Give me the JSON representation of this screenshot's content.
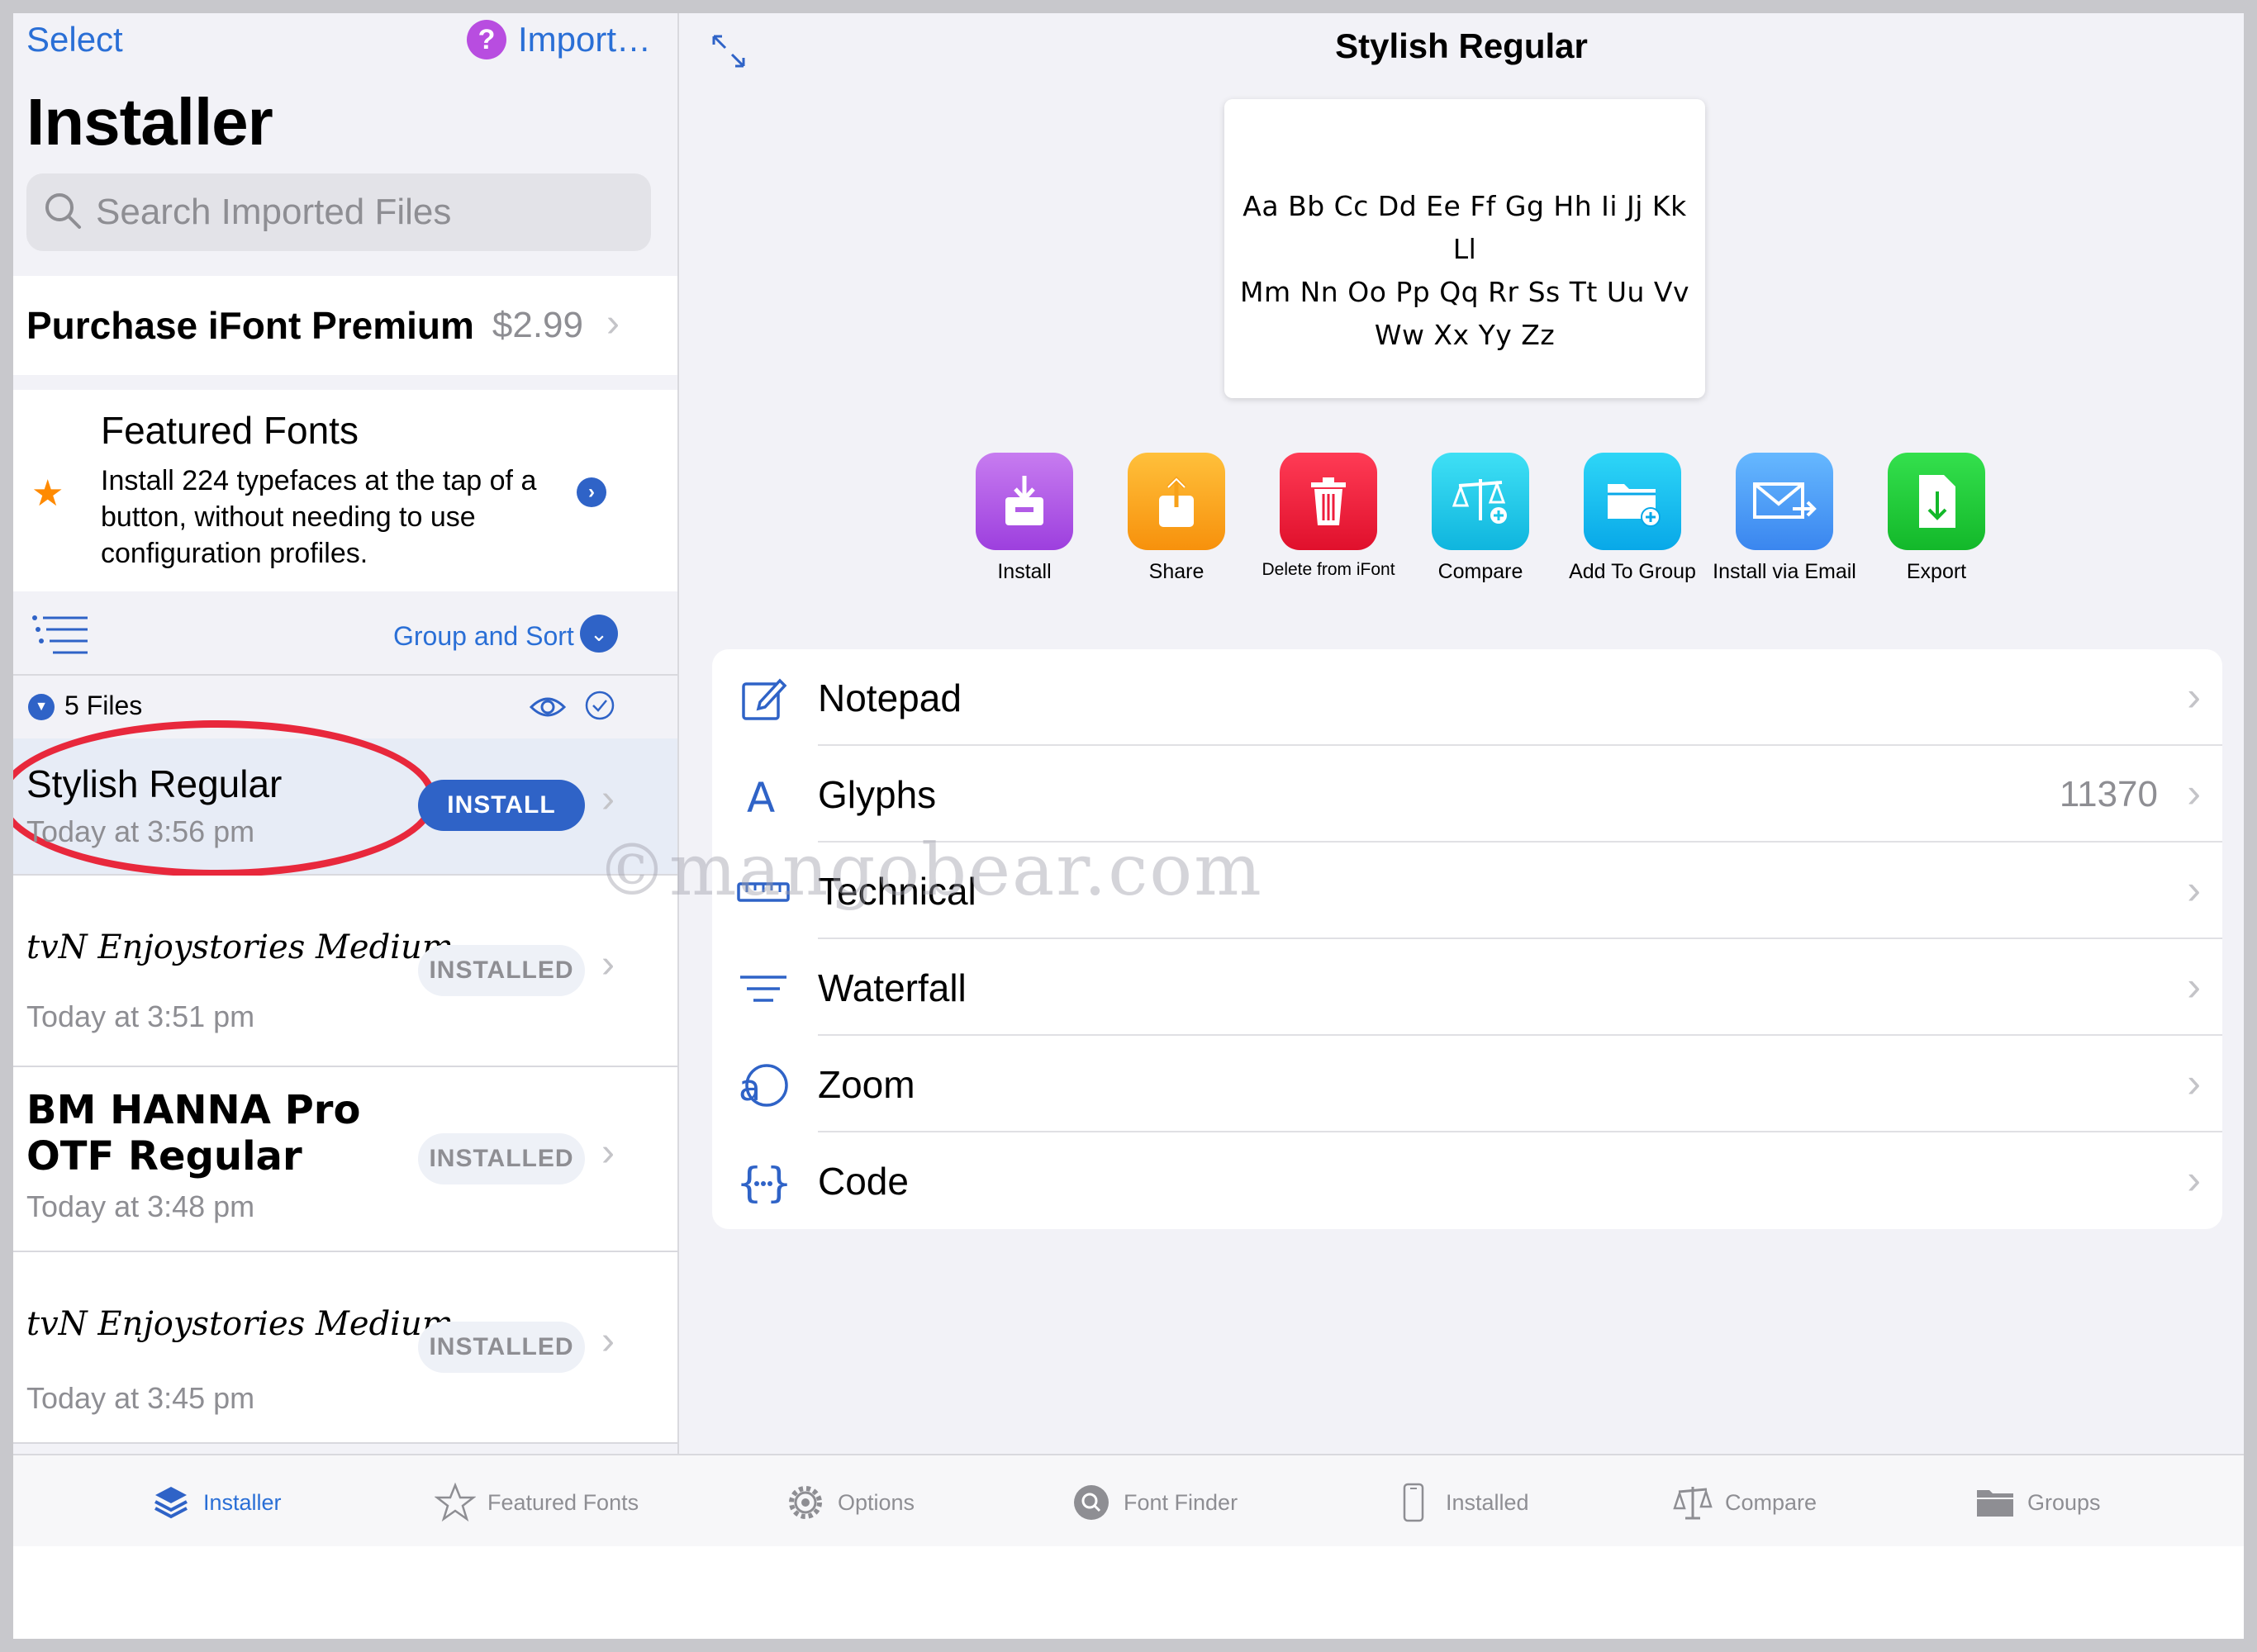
{
  "nav": {
    "select": "Select",
    "import": "Import…",
    "help_icon": "question-mark"
  },
  "sidebar": {
    "title": "Installer",
    "search_placeholder": "Search Imported Files",
    "premium": {
      "label": "Purchase iFont Premium",
      "price": "$2.99"
    },
    "featured": {
      "title": "Featured Fonts",
      "description": "Install 224 typefaces at the tap of a button, without needing to use configuration profiles."
    },
    "group_sort_label": "Group and Sort",
    "files_count": "5 Files",
    "files": [
      {
        "name": "Stylish Regular",
        "date": "Today at 3:56 pm",
        "status": "INSTALL"
      },
      {
        "name": "tvN Enjoystories Medium",
        "date": "Today at 3:51 pm",
        "status": "INSTALLED"
      },
      {
        "name": "BM HANNA Pro OTF Regular",
        "date": "Today at 3:48 pm",
        "status": "INSTALLED"
      },
      {
        "name": "tvN Enjoystories Medium",
        "date": "Today at 3:45 pm",
        "status": "INSTALLED"
      }
    ]
  },
  "detail": {
    "title": "Stylish Regular",
    "preview_lines": [
      "Aa Bb Cc Dd Ee Ff Gg Hh Ii Jj Kk Ll",
      "Mm Nn Oo Pp Qq Rr Ss Tt Uu Vv",
      "Ww Xx Yy Zz"
    ],
    "actions": [
      {
        "label": "Install",
        "icon": "install-icon",
        "color": "#b25be6"
      },
      {
        "label": "Share",
        "icon": "share-icon",
        "color": "#fba21a"
      },
      {
        "label": "Delete from iFont",
        "icon": "trash-icon",
        "color": "#ee1d3c"
      },
      {
        "label": "Compare",
        "icon": "scales-icon",
        "color": "#18c6e8"
      },
      {
        "label": "Add To Group",
        "icon": "folder-add-icon",
        "color": "#11c2f0"
      },
      {
        "label": "Install via Email",
        "icon": "email-icon",
        "color": "#4fa0f6"
      },
      {
        "label": "Export",
        "icon": "export-icon",
        "color": "#1fcf3a"
      }
    ],
    "menu": [
      {
        "label": "Notepad",
        "value": ""
      },
      {
        "label": "Glyphs",
        "value": "11370"
      },
      {
        "label": "Technical",
        "value": ""
      },
      {
        "label": "Waterfall",
        "value": ""
      },
      {
        "label": "Zoom",
        "value": ""
      },
      {
        "label": "Code",
        "value": ""
      }
    ]
  },
  "watermark": "©mangobear.com",
  "tabs": [
    {
      "label": "Installer",
      "icon": "stack-icon",
      "active": true
    },
    {
      "label": "Featured Fonts",
      "icon": "star-icon",
      "active": false
    },
    {
      "label": "Options",
      "icon": "gear-icon",
      "active": false
    },
    {
      "label": "Font Finder",
      "icon": "search-icon",
      "active": false
    },
    {
      "label": "Installed",
      "icon": "phone-icon",
      "active": false
    },
    {
      "label": "Compare",
      "icon": "scales-icon",
      "active": false
    },
    {
      "label": "Groups",
      "icon": "folder-icon",
      "active": false
    }
  ],
  "colors": {
    "accent": "#2a6fd6",
    "annotation": "#e8283c",
    "star": "#ff8a00"
  }
}
